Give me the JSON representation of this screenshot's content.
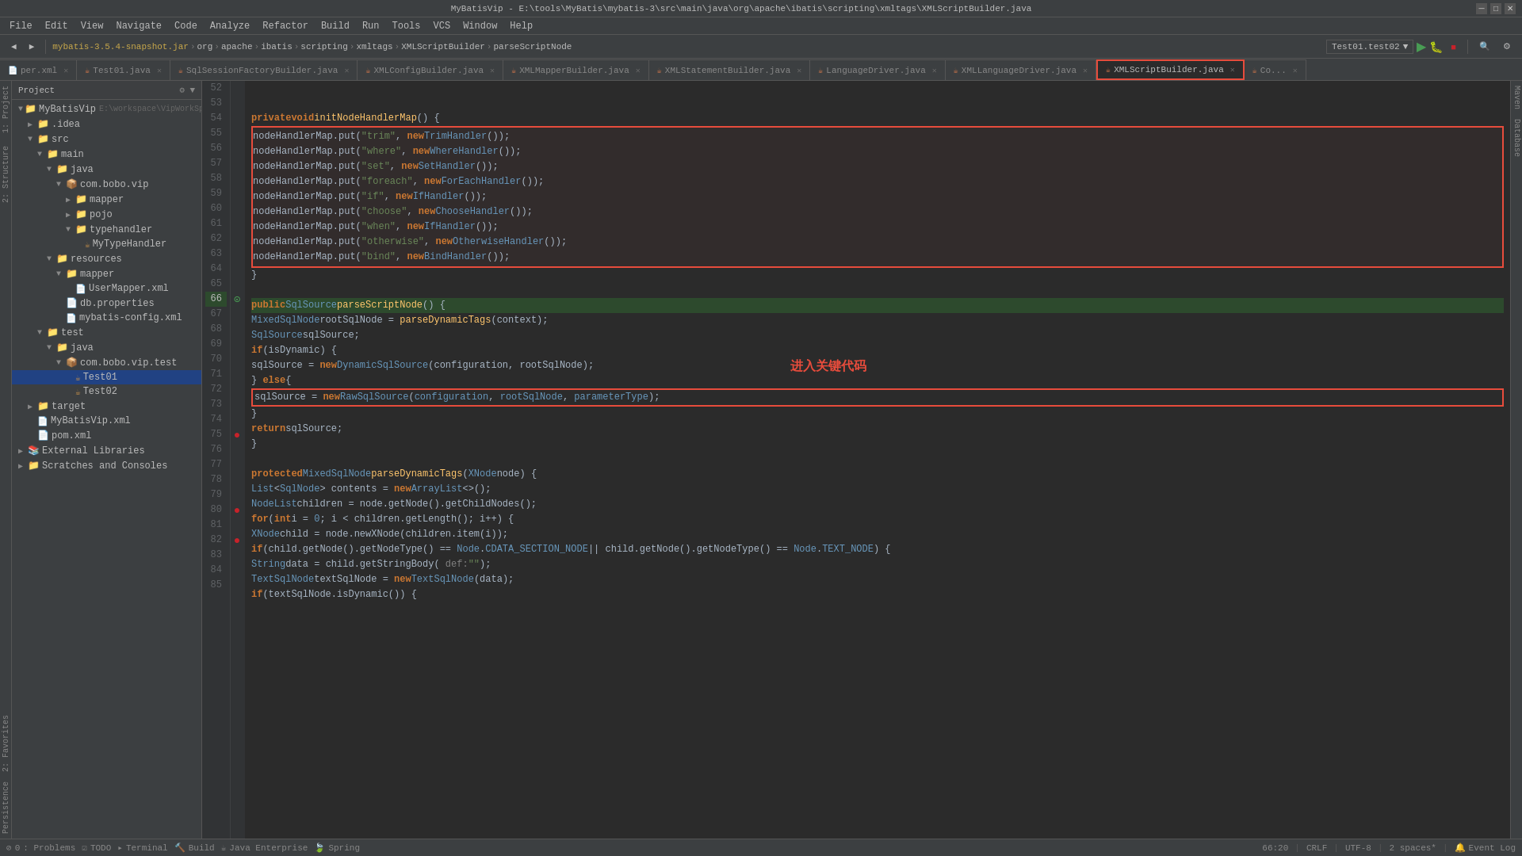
{
  "window": {
    "title": "MyBatisVip - E:\\tools\\MyBatis\\mybatis-3\\src\\main\\java\\org\\apache\\ibatis\\scripting\\xmltags\\XMLScriptBuilder.java"
  },
  "menu": {
    "items": [
      "File",
      "Edit",
      "View",
      "Navigate",
      "Code",
      "Analyze",
      "Refactor",
      "Build",
      "Run",
      "Tools",
      "VCS",
      "Window",
      "Help"
    ]
  },
  "toolbar": {
    "project_name": "mybatis-3.5.4-snapshot.jar",
    "breadcrumbs": [
      "org",
      "apache",
      "ibatis",
      "scripting",
      "xmltags",
      "XMLScriptBuilder",
      "parseScriptNode"
    ],
    "run_config": "Test01.test02"
  },
  "tabs": [
    {
      "label": "Test01.java",
      "type": "java",
      "active": false
    },
    {
      "label": "SqlSessionFactoryBuilder.java",
      "type": "java",
      "active": false
    },
    {
      "label": "XMLConfigBuilder.java",
      "type": "java",
      "active": false
    },
    {
      "label": "XMLMapperBuilder.java",
      "type": "java",
      "active": false
    },
    {
      "label": "XMLStatementBuilder.java",
      "type": "java",
      "active": false
    },
    {
      "label": "LanguageDriver.java",
      "type": "java",
      "active": false
    },
    {
      "label": "XMLLanguageDriver.java",
      "type": "java",
      "active": false
    },
    {
      "label": "XMLScriptBuilder.java",
      "type": "java",
      "active": true
    },
    {
      "label": "Co...",
      "type": "java",
      "active": false
    }
  ],
  "sidebar_left": {
    "panels": [
      "1: Project",
      "2: Favorites",
      "Persistence",
      "Structure"
    ]
  },
  "project_tree": {
    "title": "Project",
    "items": [
      {
        "label": "Project",
        "indent": 0,
        "type": "root",
        "expanded": true
      },
      {
        "label": "MyBatisVip E:\\workspace\\VipWorkSpace\\M",
        "indent": 1,
        "type": "project",
        "expanded": true
      },
      {
        "label": ".idea",
        "indent": 2,
        "type": "folder",
        "expanded": false
      },
      {
        "label": "src",
        "indent": 2,
        "type": "folder",
        "expanded": true
      },
      {
        "label": "main",
        "indent": 3,
        "type": "folder",
        "expanded": true
      },
      {
        "label": "java",
        "indent": 4,
        "type": "folder",
        "expanded": true
      },
      {
        "label": "com.bobo.vip",
        "indent": 5,
        "type": "package",
        "expanded": true
      },
      {
        "label": "mapper",
        "indent": 6,
        "type": "folder",
        "expanded": false
      },
      {
        "label": "pojo",
        "indent": 6,
        "type": "folder",
        "expanded": false
      },
      {
        "label": "typehandler",
        "indent": 6,
        "type": "folder",
        "expanded": true
      },
      {
        "label": "MyTypeHandler",
        "indent": 7,
        "type": "java",
        "selected": false
      },
      {
        "label": "resources",
        "indent": 4,
        "type": "folder",
        "expanded": true
      },
      {
        "label": "mapper",
        "indent": 5,
        "type": "folder",
        "expanded": true
      },
      {
        "label": "UserMapper.xml",
        "indent": 6,
        "type": "xml"
      },
      {
        "label": "db.properties",
        "indent": 5,
        "type": "prop"
      },
      {
        "label": "mybatis-config.xml",
        "indent": 5,
        "type": "xml"
      },
      {
        "label": "test",
        "indent": 3,
        "type": "folder",
        "expanded": true
      },
      {
        "label": "java",
        "indent": 4,
        "type": "folder",
        "expanded": true
      },
      {
        "label": "com.bobo.vip.test",
        "indent": 5,
        "type": "package",
        "expanded": true
      },
      {
        "label": "Test01",
        "indent": 6,
        "type": "java",
        "selected": true
      },
      {
        "label": "Test02",
        "indent": 6,
        "type": "java",
        "selected": false
      },
      {
        "label": "target",
        "indent": 2,
        "type": "folder",
        "expanded": false
      },
      {
        "label": "MyBatisVip.xml",
        "indent": 2,
        "type": "xml"
      },
      {
        "label": "pom.xml",
        "indent": 2,
        "type": "xml"
      },
      {
        "label": "External Libraries",
        "indent": 1,
        "type": "folder",
        "expanded": false
      },
      {
        "label": "Scratches and Consoles",
        "indent": 1,
        "type": "folder",
        "expanded": false
      }
    ]
  },
  "code": {
    "lines": [
      {
        "num": 52,
        "content": ""
      },
      {
        "num": 53,
        "content": ""
      },
      {
        "num": 54,
        "content": "  private void initNodeHandlerMap() {",
        "highlight": false
      },
      {
        "num": 55,
        "content": "    nodeHandlerMap.put(\"trim\", new TrimHandler());",
        "boxed": true
      },
      {
        "num": 56,
        "content": "    nodeHandlerMap.put(\"where\", new WhereHandler());",
        "boxed": true
      },
      {
        "num": 57,
        "content": "    nodeHandlerMap.put(\"set\", new SetHandler());",
        "boxed": true
      },
      {
        "num": 58,
        "content": "    nodeHandlerMap.put(\"foreach\", new ForEachHandler());",
        "boxed": true
      },
      {
        "num": 59,
        "content": "    nodeHandlerMap.put(\"if\", new IfHandler());",
        "boxed": true
      },
      {
        "num": 60,
        "content": "    nodeHandlerMap.put(\"choose\", new ChooseHandler());",
        "boxed": true
      },
      {
        "num": 61,
        "content": "    nodeHandlerMap.put(\"when\", new IfHandler());",
        "boxed": true
      },
      {
        "num": 62,
        "content": "    nodeHandlerMap.put(\"otherwise\", new OtherwiseHandler());",
        "boxed": true
      },
      {
        "num": 63,
        "content": "    nodeHandlerMap.put(\"bind\", new BindHandler());",
        "boxed": true
      },
      {
        "num": 64,
        "content": "  }"
      },
      {
        "num": 65,
        "content": ""
      },
      {
        "num": 66,
        "content": "  public SqlSource parseScriptNode() {",
        "highlight": true
      },
      {
        "num": 67,
        "content": "    MixedSqlNode rootSqlNode = parseDynamicTags(context);"
      },
      {
        "num": 68,
        "content": "    SqlSource sqlSource;"
      },
      {
        "num": 69,
        "content": "    if (isDynamic) {"
      },
      {
        "num": 70,
        "content": "      sqlSource = new DynamicSqlSource(configuration, rootSqlNode);"
      },
      {
        "num": 71,
        "content": "    } else {"
      },
      {
        "num": 72,
        "content": "      sqlSource = new RawSqlSource(configuration, rootSqlNode, parameterType);",
        "boxed2": true
      },
      {
        "num": 73,
        "content": "    }"
      },
      {
        "num": 74,
        "content": "    return sqlSource;"
      },
      {
        "num": 75,
        "content": "  }",
        "breakpoint": true
      },
      {
        "num": 76,
        "content": ""
      },
      {
        "num": 77,
        "content": "  protected MixedSqlNode parseDynamicTags(XNode node) {"
      },
      {
        "num": 78,
        "content": "    List<SqlNode> contents = new ArrayList<>();"
      },
      {
        "num": 79,
        "content": "    NodeList children = node.getNode().getChildNodes();"
      },
      {
        "num": 80,
        "content": "    for (int i = 0; i < children.getLength(); i++) {",
        "breakpoint": true
      },
      {
        "num": 81,
        "content": "      XNode child = node.newXNode(children.item(i));"
      },
      {
        "num": 82,
        "content": "      if (child.getNode().getNodeType() == Node.CDATA_SECTION_NODE || child.getNode().getNodeType() == Node.TEXT_NODE) {",
        "breakpoint": true
      },
      {
        "num": 83,
        "content": "        String data = child.getStringBody( def: \"\");"
      },
      {
        "num": 84,
        "content": "        TextSqlNode textSqlNode = new TextSqlNode(data);"
      },
      {
        "num": 85,
        "content": "        if (textSqlNode.isDynamic()) {"
      }
    ],
    "annotation": "进入关键代码"
  },
  "status_bar": {
    "problems": "0",
    "todo": "TODO",
    "terminal": "Terminal",
    "build": "Build",
    "java_enterprise": "Java Enterprise",
    "spring": "Spring",
    "position": "66:20",
    "crlf": "CRLF",
    "encoding": "UTF-8",
    "indent": "2 spaces*",
    "event_log": "Event Log"
  }
}
